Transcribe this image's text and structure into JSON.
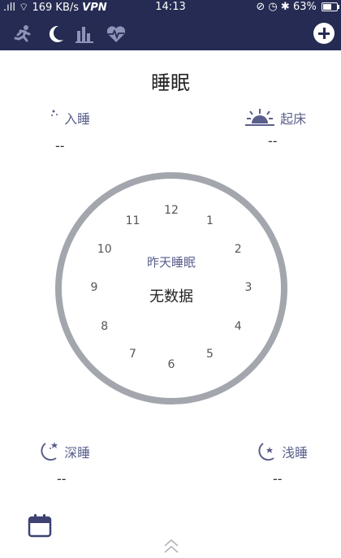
{
  "status_bar": {
    "network_speed": "169 KB/s",
    "vpn": "VPN",
    "time": "14:13",
    "battery_percent": "63%",
    "battery_level": 0.63
  },
  "toolbar": {
    "tabs": [
      {
        "icon": "running-icon"
      },
      {
        "icon": "moon-icon"
      },
      {
        "icon": "bar-chart-icon"
      },
      {
        "icon": "heart-rate-icon"
      }
    ],
    "add_icon": "plus-icon"
  },
  "page": {
    "title": "睡眠"
  },
  "sleep_time": {
    "label": "入睡",
    "value": "--"
  },
  "wake_time": {
    "label": "起床",
    "value": "--"
  },
  "clock": {
    "subtitle": "昨天睡眠",
    "status": "无数据",
    "numbers": [
      "12",
      "1",
      "2",
      "3",
      "4",
      "5",
      "6",
      "7",
      "8",
      "9",
      "10",
      "11"
    ]
  },
  "deep_sleep": {
    "label": "深睡",
    "value": "--"
  },
  "light_sleep": {
    "label": "浅睡",
    "value": "--"
  },
  "colors": {
    "header_bg": "#252b52",
    "accent": "#5a5f8c",
    "ring": "#a3a6ad"
  }
}
